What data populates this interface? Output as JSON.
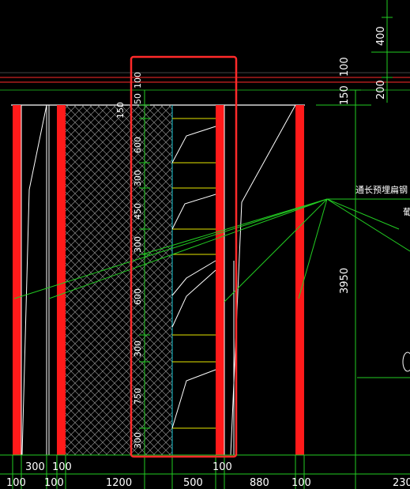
{
  "colors": {
    "background": "#000000",
    "column_red": "#ff1a1a",
    "green": "#22cc22",
    "cyan": "#1ec9d6",
    "yellow": "#e6e600",
    "white": "#ffffff",
    "highlight": "#ff2a2a"
  },
  "bottom_dims": {
    "row1": [
      "300",
      "100"
    ],
    "row2": [
      "100",
      "100",
      "1200",
      "500",
      "100",
      "880",
      "100",
      "230"
    ]
  },
  "right_dims": {
    "d400": "400",
    "d100": "100",
    "d200": "200",
    "d150": "150",
    "d3950": "3950"
  },
  "annotation": {
    "label": "通长预埋扁钢",
    "label2": "葡"
  },
  "vertical_dims": [
    "100",
    "50",
    "150",
    "600",
    "300",
    "450",
    "300",
    "600",
    "300",
    "750",
    "300"
  ]
}
